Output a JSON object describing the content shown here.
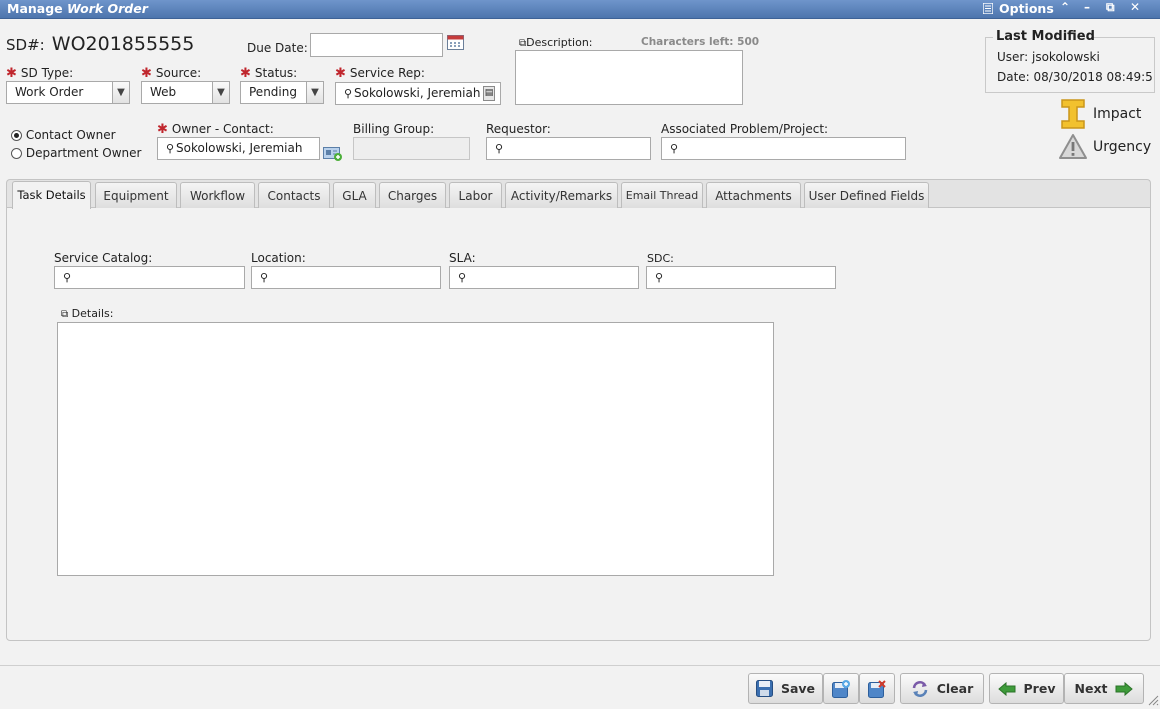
{
  "window": {
    "title_prefix": "Manage",
    "title_italic": "Work Order",
    "options_label": "Options",
    "icons": [
      "list-icon",
      "collapse-icon",
      "minimize-icon",
      "popout-icon",
      "close-icon"
    ]
  },
  "header": {
    "sd_label": "SD#:",
    "sd_number": "WO201855555",
    "due_date_label": "Due Date:",
    "due_date_value": "",
    "description_label": "Description:",
    "chars_left": "Characters left: 500",
    "description_value": ""
  },
  "fields": {
    "sd_type": {
      "label": "SD Type:",
      "value": "Work Order"
    },
    "source": {
      "label": "Source:",
      "value": "Web"
    },
    "status": {
      "label": "Status:",
      "value": "Pending"
    },
    "service_rep": {
      "label": "Service Rep:",
      "value": "Sokolowski, Jeremiah"
    },
    "owner_contact": {
      "label": "Owner - Contact:",
      "value": "Sokolowski, Jeremiah"
    },
    "billing_group": {
      "label": "Billing Group:",
      "value": ""
    },
    "requestor": {
      "label": "Requestor:",
      "value": ""
    },
    "associated": {
      "label": "Associated Problem/Project:",
      "value": ""
    }
  },
  "owner_type": {
    "options": [
      "Contact Owner",
      "Department Owner"
    ],
    "selected": "Contact Owner"
  },
  "last_modified": {
    "title": "Last Modified",
    "user": "User: jsokolowski",
    "date": "Date: 08/30/2018 08:49:5"
  },
  "indicators": {
    "impact": "Impact",
    "urgency": "Urgency",
    "colors": {
      "impact": "#f2c12e",
      "urgency": "#9a9a9a"
    }
  },
  "tabs": [
    "Task Details",
    "Equipment",
    "Workflow",
    "Contacts",
    "GLA",
    "Charges",
    "Labor",
    "Activity/Remarks",
    "Email Thread",
    "Attachments",
    "User Defined Fields"
  ],
  "active_tab": "Task Details",
  "task_details": {
    "service_catalog": {
      "label": "Service Catalog:",
      "value": ""
    },
    "location": {
      "label": "Location:",
      "value": ""
    },
    "sla": {
      "label": "SLA:",
      "value": ""
    },
    "sdc": {
      "label": "SDC:",
      "value": ""
    },
    "details_label": "Details:",
    "details_value": ""
  },
  "buttons": {
    "save": "Save",
    "clear": "Clear",
    "prev": "Prev",
    "next": "Next",
    "save_new_icon": "save-new-icon",
    "save_close_icon": "save-close-icon"
  },
  "accent": "#5a7fb6"
}
